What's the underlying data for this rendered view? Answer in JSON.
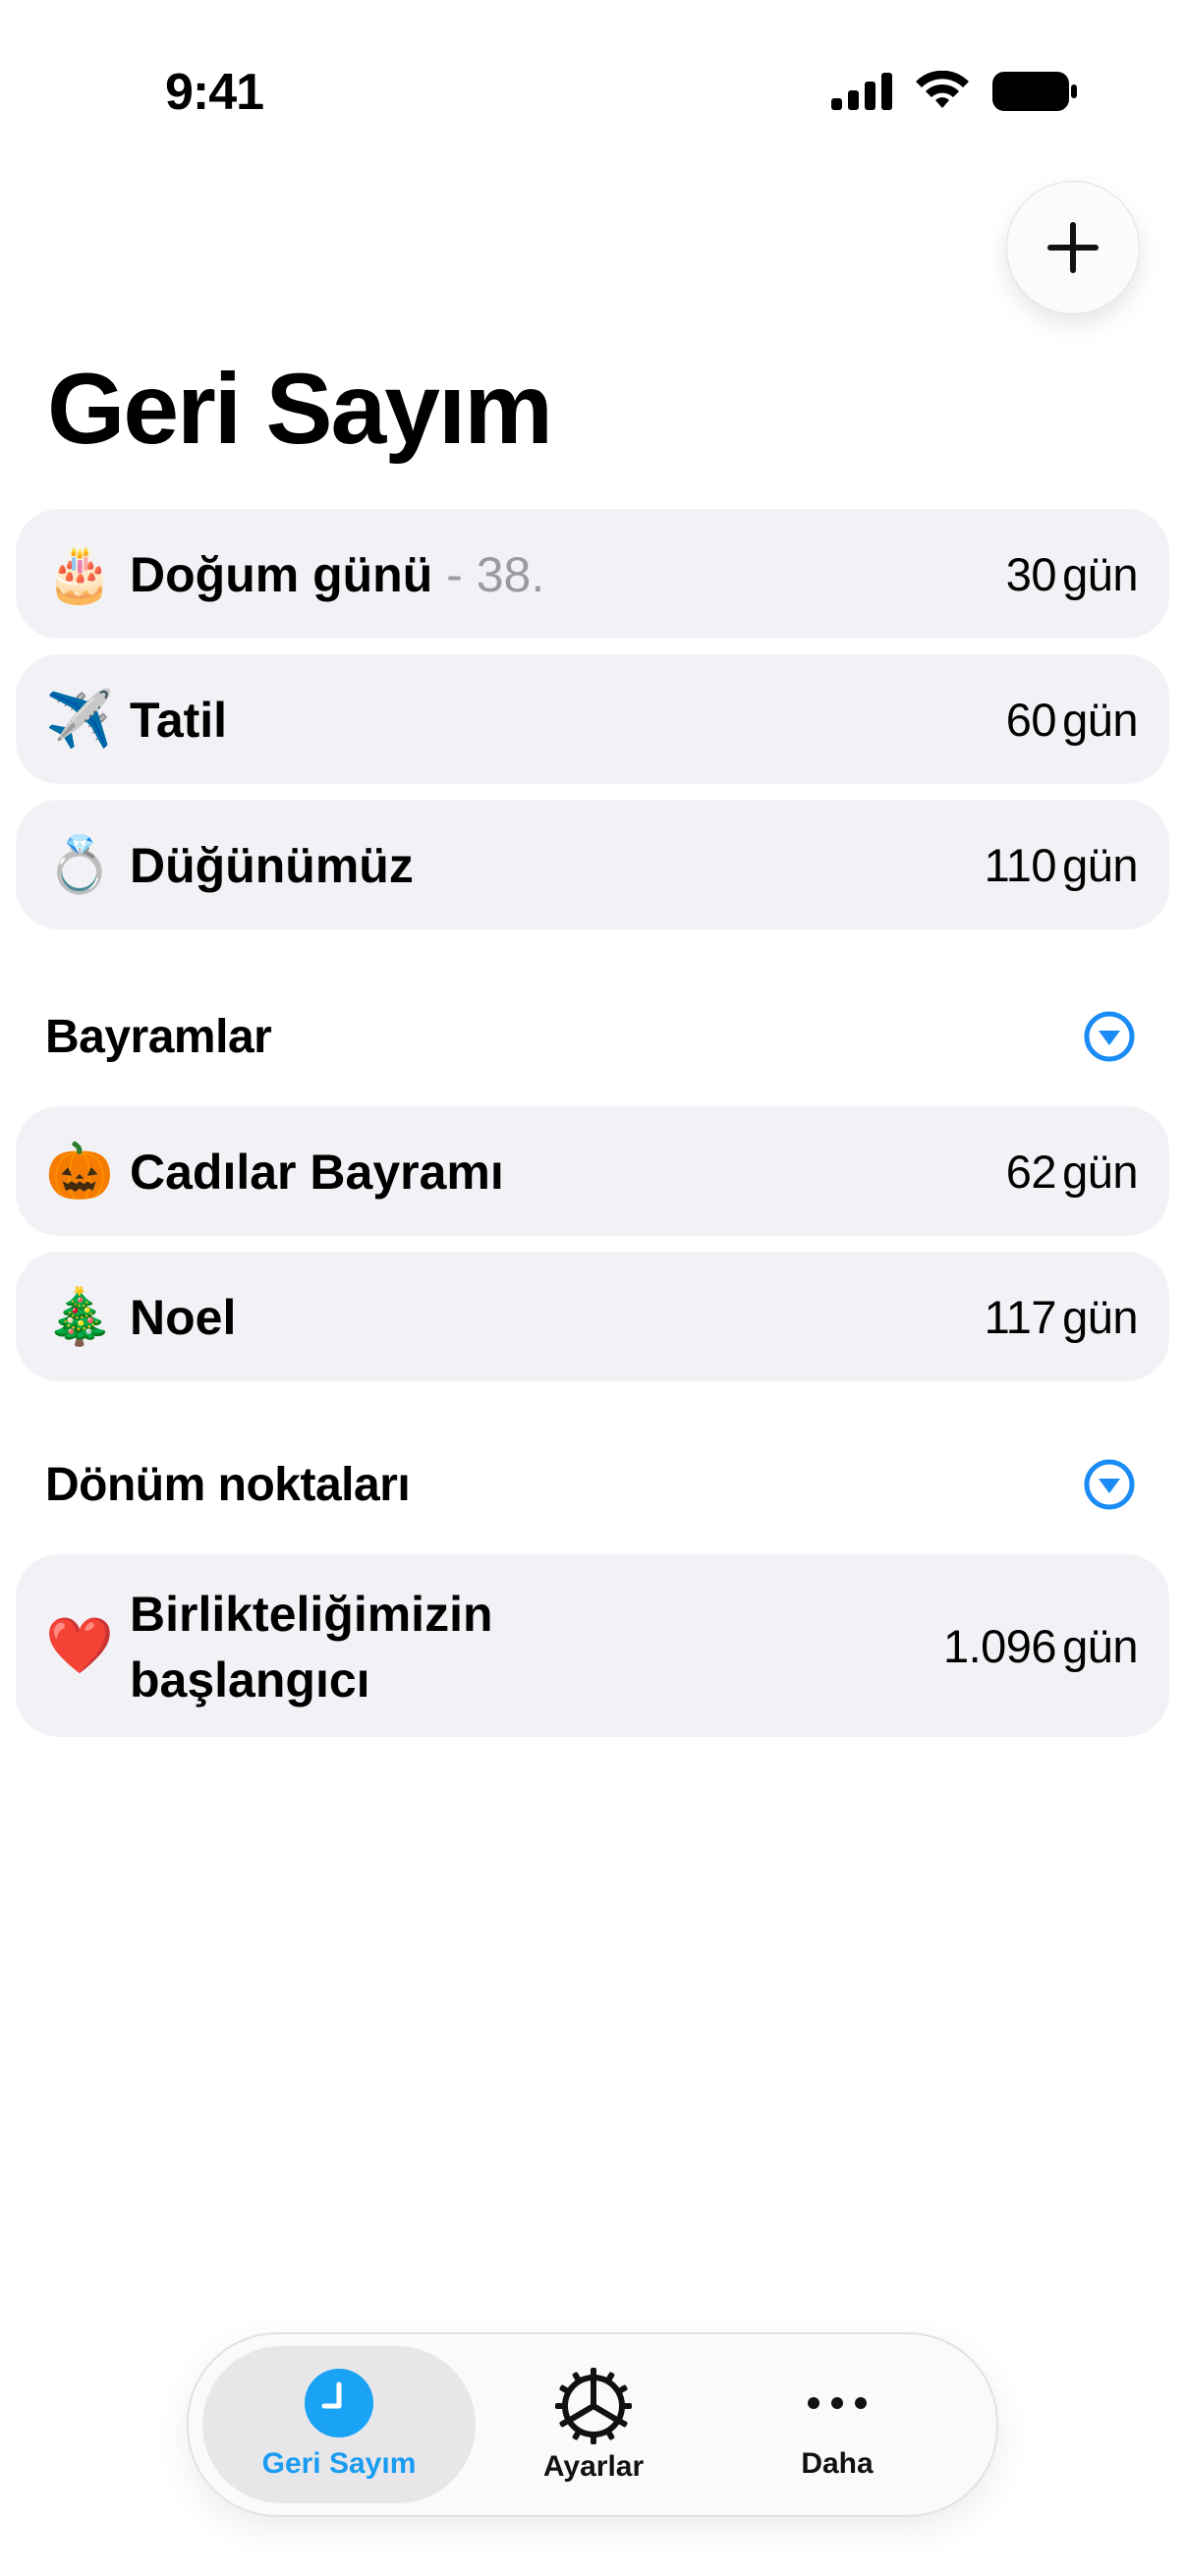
{
  "status_bar": {
    "time": "9:41"
  },
  "header": {
    "title": "Geri Sayım"
  },
  "countdowns": [
    {
      "emoji": "🎂",
      "emoji_name": "birthday-cake-icon",
      "title": "Doğum günü",
      "subtitle": " - 38.",
      "days": "30",
      "unit": "gün"
    },
    {
      "emoji": "✈️",
      "emoji_name": "airplane-icon",
      "title": "Tatil",
      "subtitle": "",
      "days": "60",
      "unit": "gün"
    },
    {
      "emoji": "💍",
      "emoji_name": "ring-icon",
      "title": "Düğünümüz",
      "subtitle": "",
      "days": "110",
      "unit": "gün"
    }
  ],
  "sections": [
    {
      "title": "Bayramlar",
      "items": [
        {
          "emoji": "🎃",
          "emoji_name": "pumpkin-icon",
          "title": "Cadılar Bayramı",
          "days": "62",
          "unit": "gün"
        },
        {
          "emoji": "🎄",
          "emoji_name": "christmas-tree-icon",
          "title": "Noel",
          "days": "117",
          "unit": "gün"
        }
      ]
    },
    {
      "title": "Dönüm noktaları",
      "items": [
        {
          "emoji": "❤️",
          "emoji_name": "heart-icon",
          "title_line1": "Birlikteliğimizin",
          "title_line2": "başlangıcı",
          "days": "1.096",
          "unit": "gün"
        }
      ]
    }
  ],
  "tabbar": {
    "tabs": [
      {
        "label": "Geri Sayım",
        "icon": "clock-icon",
        "active": true
      },
      {
        "label": "Ayarlar",
        "icon": "gear-icon",
        "active": false
      },
      {
        "label": "Daha",
        "icon": "more-icon",
        "active": false
      }
    ]
  },
  "colors": {
    "accent": "#1a8cf5",
    "row_background": "#f2f2f6",
    "subtitle_gray": "#9a9aa0"
  }
}
